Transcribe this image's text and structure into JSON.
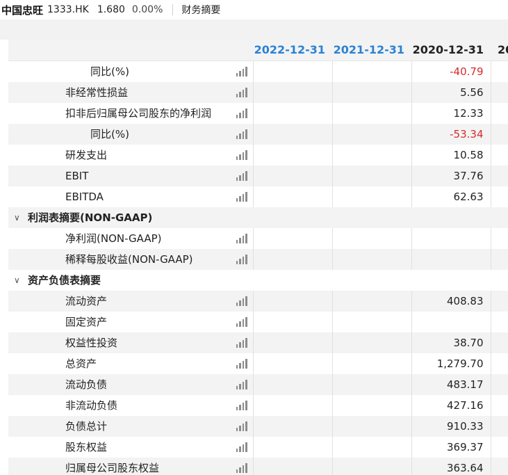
{
  "header": {
    "stock_name": "中国忠旺",
    "stock_code": "1333.HK",
    "price": "1.680",
    "change_pct": "0.00%",
    "page_title": "财务摘要"
  },
  "columns": [
    "2022-12-31",
    "2021-12-31",
    "2020-12-31",
    "20"
  ],
  "rows": [
    {
      "type": "item",
      "label": "同比(%)",
      "indent": 2,
      "values": [
        "",
        "",
        "-40.79",
        ""
      ],
      "negative": true
    },
    {
      "type": "item",
      "label": "非经常性损益",
      "indent": 1,
      "values": [
        "",
        "",
        "5.56",
        ""
      ]
    },
    {
      "type": "item",
      "label": "扣非后归属母公司股东的净利润",
      "indent": 1,
      "values": [
        "",
        "",
        "12.33",
        ""
      ]
    },
    {
      "type": "item",
      "label": "同比(%)",
      "indent": 2,
      "values": [
        "",
        "",
        "-53.34",
        ""
      ],
      "negative": true
    },
    {
      "type": "item",
      "label": "研发支出",
      "indent": 1,
      "values": [
        "",
        "",
        "10.58",
        ""
      ]
    },
    {
      "type": "item",
      "label": "EBIT",
      "indent": 1,
      "values": [
        "",
        "",
        "37.76",
        ""
      ]
    },
    {
      "type": "item",
      "label": "EBITDA",
      "indent": 1,
      "values": [
        "",
        "",
        "62.63",
        ""
      ]
    },
    {
      "type": "section",
      "label": "利润表摘要(NON-GAAP)"
    },
    {
      "type": "item",
      "label": "净利润(NON-GAAP)",
      "indent": 1,
      "values": [
        "",
        "",
        "",
        ""
      ]
    },
    {
      "type": "item",
      "label": "稀释每股收益(NON-GAAP)",
      "indent": 1,
      "values": [
        "",
        "",
        "",
        ""
      ]
    },
    {
      "type": "section",
      "label": "资产负债表摘要"
    },
    {
      "type": "item",
      "label": "流动资产",
      "indent": 1,
      "values": [
        "",
        "",
        "408.83",
        ""
      ]
    },
    {
      "type": "item",
      "label": "固定资产",
      "indent": 1,
      "values": [
        "",
        "",
        "",
        ""
      ]
    },
    {
      "type": "item",
      "label": "权益性投资",
      "indent": 1,
      "values": [
        "",
        "",
        "38.70",
        ""
      ]
    },
    {
      "type": "item",
      "label": "总资产",
      "indent": 1,
      "values": [
        "",
        "",
        "1,279.70",
        ""
      ]
    },
    {
      "type": "item",
      "label": "流动负债",
      "indent": 1,
      "values": [
        "",
        "",
        "483.17",
        ""
      ]
    },
    {
      "type": "item",
      "label": "非流动负债",
      "indent": 1,
      "values": [
        "",
        "",
        "427.16",
        ""
      ]
    },
    {
      "type": "item",
      "label": "负债总计",
      "indent": 1,
      "values": [
        "",
        "",
        "910.33",
        ""
      ]
    },
    {
      "type": "item",
      "label": "股东权益",
      "indent": 1,
      "values": [
        "",
        "",
        "369.37",
        ""
      ]
    },
    {
      "type": "item",
      "label": "归属母公司股东权益",
      "indent": 1,
      "values": [
        "",
        "",
        "363.64",
        ""
      ]
    }
  ],
  "colors": {
    "accent_blue": "#2a82d4",
    "negative_red": "#d9292a",
    "stripe": "#f3f3f3"
  },
  "icons": {
    "row_chart": "bar-chart-icon",
    "section_toggle": "chevron-down-icon"
  }
}
